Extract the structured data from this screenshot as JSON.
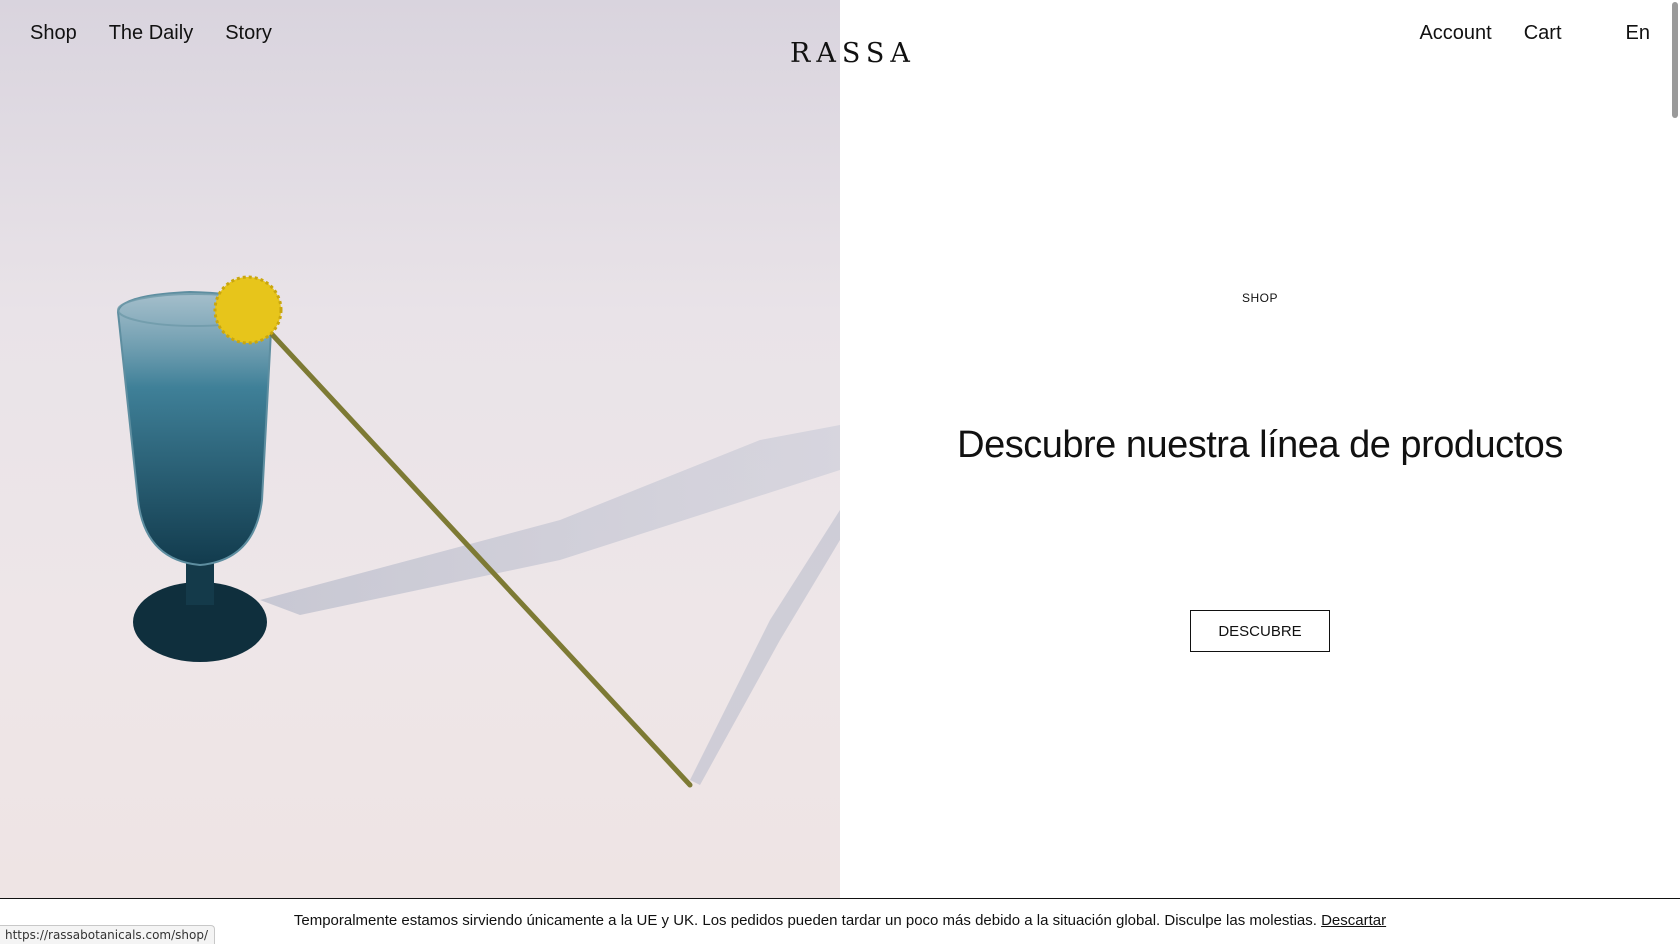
{
  "header": {
    "nav_left": [
      "Shop",
      "The Daily",
      "Story"
    ],
    "logo": "RASSA",
    "nav_right": [
      "Account",
      "Cart"
    ],
    "language": "En"
  },
  "hero": {
    "image_description_icon": "glass-with-yellow-flower-image",
    "eyebrow": "SHOP",
    "headline": "Descubre nuestra línea de productos",
    "cta_label": "DESCUBRE"
  },
  "notice": {
    "text": "Temporalmente estamos sirviendo únicamente a la UE y UK. Los pedidos pueden tardar un poco más debido a la situación global. Disculpe las molestias.",
    "dismiss_label": "Descartar"
  },
  "status_bar": {
    "url": "https://rassabotanicals.com/shop/"
  },
  "colors": {
    "text": "#111111",
    "background": "#ffffff",
    "image_bg": "#e9e3e8",
    "glass": "#1f5f78",
    "flower": "#e8c81a"
  }
}
